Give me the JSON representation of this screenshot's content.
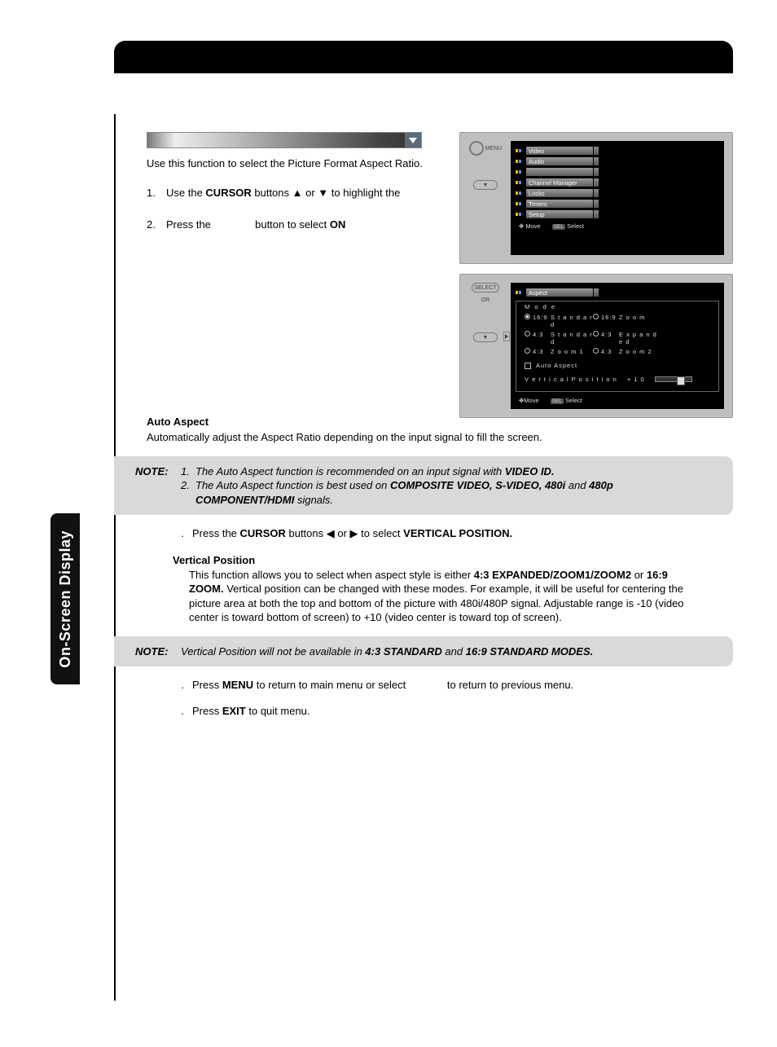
{
  "sideTab": "On-Screen Display",
  "intro": "Use this function to select the Picture Format Aspect Ratio.",
  "step1": {
    "n": "1.",
    "pre": "Use the ",
    "b1": "CURSOR",
    "mid": " buttons ▲ or ▼ to highlight the"
  },
  "step2": {
    "n": "2.",
    "pre": "Press the ",
    "gap": "              ",
    "mid": "button to select ",
    "b1": "ON"
  },
  "osd1": {
    "leftRing": "MENU",
    "leftPill": "▼",
    "items": [
      "Video",
      "Audio",
      "",
      "Channel Manager",
      "Locks",
      "Timers",
      "Setup"
    ],
    "status": {
      "move": "Move",
      "selKey": "SEL",
      "select": "Select"
    }
  },
  "osd2": {
    "leftRing": "SELECT",
    "leftOr": "OR",
    "leftPill": "▼",
    "header": "Aspect",
    "modeLabel": "M o d e",
    "modes": [
      {
        "r": "16:9",
        "l": "S t a n d a r d",
        "sel": true
      },
      {
        "r": "4:3",
        "l": "S t a n d a r d",
        "sel": false
      },
      {
        "r": "4:3",
        "l": "Z o o m 1",
        "sel": false
      },
      {
        "r": "16:9",
        "l": "Z o o m",
        "sel": false
      },
      {
        "r": "4:3",
        "l": "E x p a n d e d",
        "sel": false
      },
      {
        "r": "4:3",
        "l": "Z o o m 2",
        "sel": false
      }
    ],
    "autoAspect": "Auto Aspect",
    "vpLabel": "V e r t i c a l   P o s i t i o n",
    "vpVal": "+ 1 0",
    "status": {
      "move": "Move",
      "selKey": "SEL",
      "select": "Select"
    }
  },
  "autoAspect": {
    "h": "Auto Aspect",
    "p": "Automatically adjust the Aspect Ratio depending on the input signal to fill the screen."
  },
  "note1": {
    "lbl": "NOTE:",
    "r1": {
      "n": "1.",
      "t1": "The Auto Aspect function is recommended on an input signal with ",
      "b1": "VIDEO ID.",
      "t2": ""
    },
    "r2": {
      "n": "2.",
      "t1": "The Auto Aspect function is best used on ",
      "b1": "COMPOSITE VIDEO, S-VIDEO, 480i",
      "t2": " and ",
      "b2": "480p COMPONENT/HDMI",
      "t3": " signals."
    }
  },
  "step3": {
    "n": ".",
    "t1": "Press the ",
    "b1": "CURSOR",
    "t2": " buttons ◀ or ▶ to select ",
    "b2": "VERTICAL POSITION."
  },
  "vp": {
    "h": "Vertical Position",
    "t1": "This function allows you to select when aspect style is either ",
    "b1": "4:3 EXPANDED/ZOOM1/ZOOM2",
    "t2": " or ",
    "b2": "16:9 ZOOM.",
    "t3": " Vertical position can be changed with these modes. For example, it will be useful for centering the picture area at both the top and bottom of the picture with 480i/480P signal. Adjustable range is -10 (video center is toward bottom of screen) to +10 (video center is toward top of screen)."
  },
  "note2": {
    "lbl": "NOTE:",
    "t1": "Vertical Position will not be available in ",
    "b1": "4:3 STANDARD",
    "t2": " and ",
    "b2": "16:9 STANDARD MODES."
  },
  "step5": {
    "n": ".",
    "t1": "Press ",
    "b1": "MENU",
    "t2": " to return to main menu or select",
    "gap": "              ",
    "t3": "to return to previous menu."
  },
  "step6": {
    "n": ".",
    "t1": "Press ",
    "b1": "EXIT",
    "t2": " to quit menu."
  }
}
